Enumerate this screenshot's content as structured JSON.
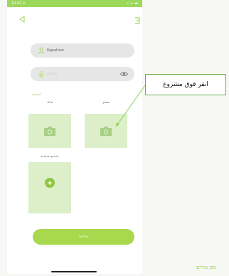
{
  "status_bar": {
    "time": "10:41 ⚲",
    "icons": "..ıl ≈ ▬"
  },
  "login": {
    "username_value": "Ngealtest",
    "password_placeholder": "סיסמה"
  },
  "link_text": "שכחתי?",
  "photos": {
    "left_label": "סלפי",
    "right_label": "מסמך"
  },
  "add_box_label": "להוסיף מוצרים",
  "primary_button_label": "שליחה",
  "callout_text": "انقر فوق مشروع",
  "brand_text": "מכן עיניים",
  "icons": {
    "back": "back-arrow-icon",
    "menu": "menu-icon",
    "user": "user-icon",
    "lock": "lock-icon",
    "eye": "eye-icon",
    "camera": "camera-icon",
    "plus": "plus-icon"
  },
  "colors": {
    "accent": "#9cd85a",
    "box_fill": "#dcefc9",
    "button": "#a7d84d",
    "callout_border": "#6bb24a"
  }
}
